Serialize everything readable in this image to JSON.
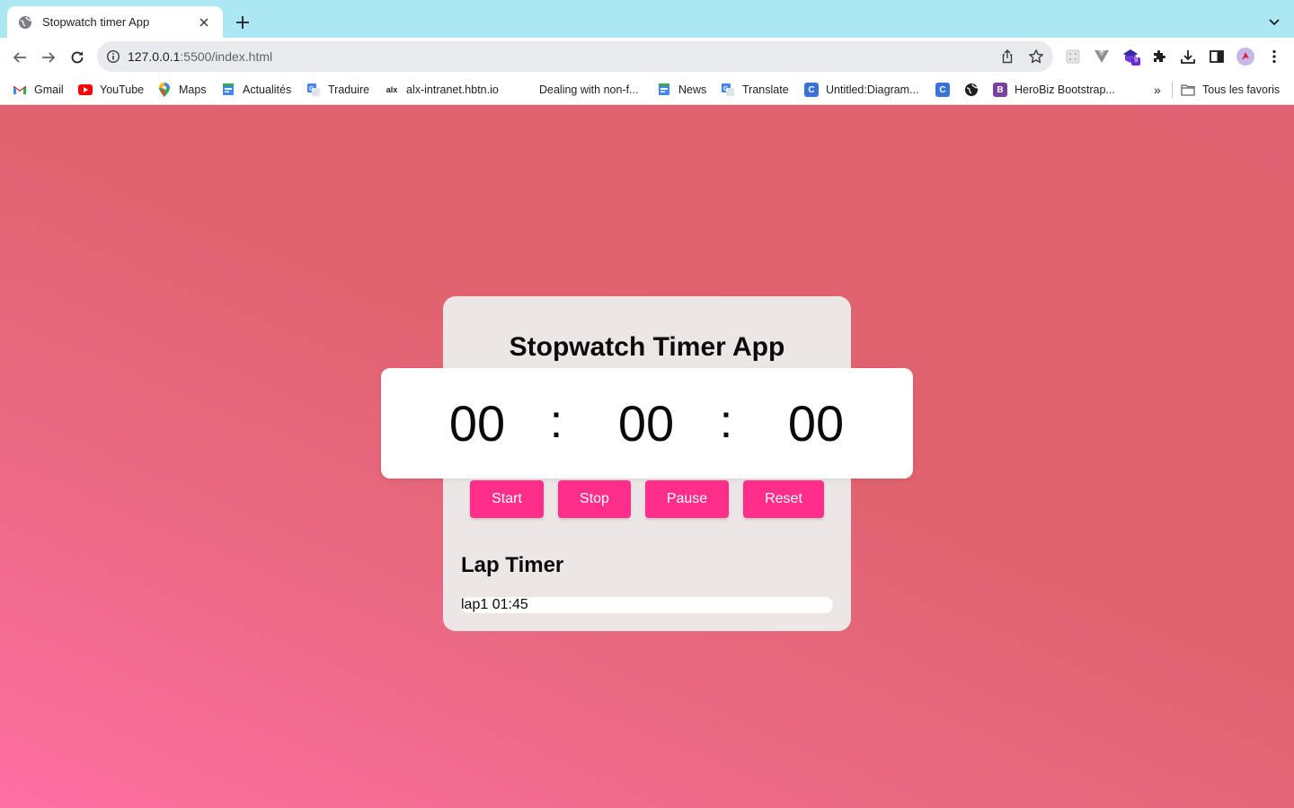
{
  "browser": {
    "tab_title": "Stopwatch timer App",
    "url_host": "127.0.0.1",
    "url_rest": ":5500/index.html",
    "ext_badge": "9",
    "bookmarks": [
      {
        "label": "Gmail",
        "icon": "gmail-icon"
      },
      {
        "label": "YouTube",
        "icon": "youtube-icon"
      },
      {
        "label": "Maps",
        "icon": "maps-icon"
      },
      {
        "label": "Actualités",
        "icon": "news-icon"
      },
      {
        "label": "Traduire",
        "icon": "translate-icon"
      },
      {
        "label": "alx-intranet.hbtn.io",
        "icon": "alx-icon"
      },
      {
        "label": "Dealing with non-f...",
        "icon": ""
      },
      {
        "label": "News",
        "icon": "news-icon"
      },
      {
        "label": "Translate",
        "icon": "translate-icon"
      },
      {
        "label": "Untitled:Diagram...",
        "icon": "diagram-icon"
      },
      {
        "label": "HeroBiz Bootstrap...",
        "icon": "bootstrap-icon"
      }
    ],
    "overflow_label": "»",
    "all_bookmarks_label": "Tous les favoris"
  },
  "app": {
    "title": "Stopwatch Timer App",
    "hours": "00",
    "minutes": "00",
    "seconds": "00",
    "separator": ":",
    "buttons": {
      "start": "Start",
      "stop": "Stop",
      "pause": "Pause",
      "reset": "Reset"
    },
    "lap_heading": "Lap Timer",
    "laps": [
      "lap1 01:45"
    ]
  },
  "colors": {
    "button": "#ff2e8a",
    "card": "#ede6e6",
    "background_top": "#e0616f",
    "background_bottom": "#ff6fa3"
  }
}
